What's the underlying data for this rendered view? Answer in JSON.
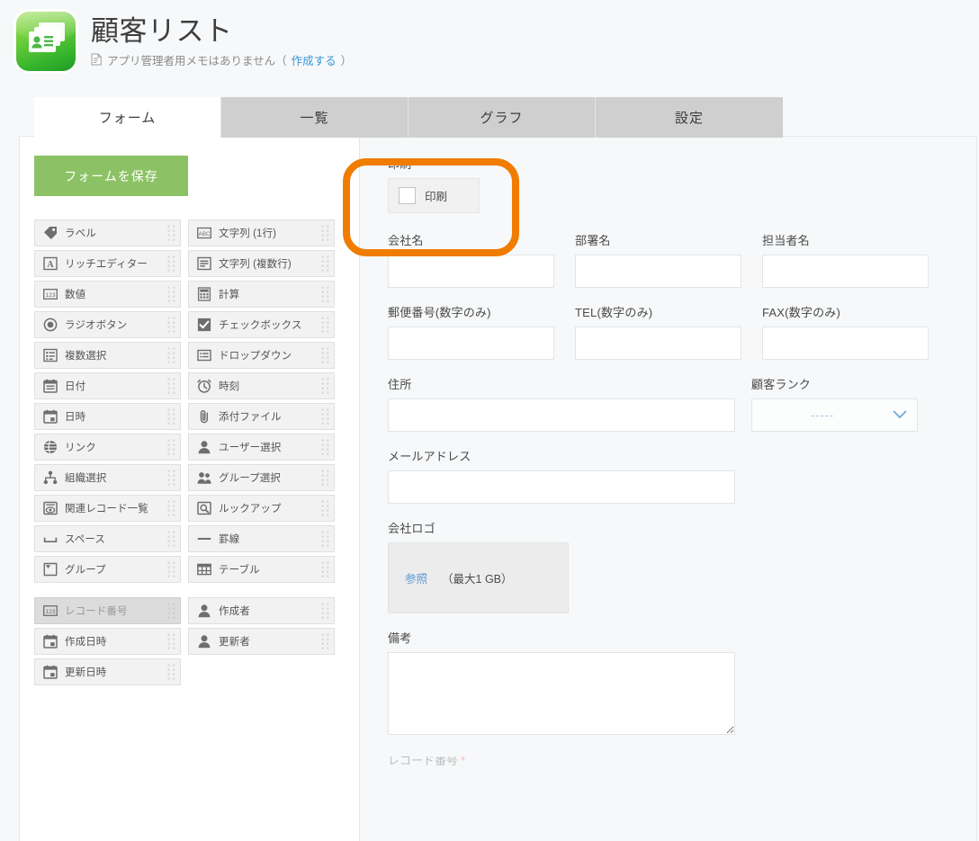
{
  "header": {
    "app_icon_name": "contact-cards-icon",
    "title": "顧客リスト",
    "note_icon": "memo-icon",
    "note_text": "アプリ管理者用メモはありません（",
    "note_link": "作成する",
    "note_suffix": "）"
  },
  "tabs": [
    {
      "label": "フォーム",
      "active": true
    },
    {
      "label": "一覧",
      "active": false
    },
    {
      "label": "グラフ",
      "active": false
    },
    {
      "label": "設定",
      "active": false
    }
  ],
  "palette": {
    "save_label": "フォームを保存",
    "fields": [
      {
        "label": "ラベル",
        "icon": "tag-icon"
      },
      {
        "label": "文字列 (1行)",
        "icon": "abc-icon"
      },
      {
        "label": "リッチエディター",
        "icon": "rich-text-icon"
      },
      {
        "label": "文字列 (複数行)",
        "icon": "multiline-text-icon"
      },
      {
        "label": "数値",
        "icon": "number-123-icon"
      },
      {
        "label": "計算",
        "icon": "calculator-icon"
      },
      {
        "label": "ラジオボタン",
        "icon": "radio-button-icon"
      },
      {
        "label": "チェックボックス",
        "icon": "checkbox-icon"
      },
      {
        "label": "複数選択",
        "icon": "multi-select-icon"
      },
      {
        "label": "ドロップダウン",
        "icon": "dropdown-icon"
      },
      {
        "label": "日付",
        "icon": "calendar-icon"
      },
      {
        "label": "時刻",
        "icon": "clock-icon"
      },
      {
        "label": "日時",
        "icon": "calendar-time-icon"
      },
      {
        "label": "添付ファイル",
        "icon": "paperclip-icon"
      },
      {
        "label": "リンク",
        "icon": "globe-link-icon"
      },
      {
        "label": "ユーザー選択",
        "icon": "user-icon"
      },
      {
        "label": "組織選択",
        "icon": "org-tree-icon"
      },
      {
        "label": "グループ選択",
        "icon": "group-users-icon"
      },
      {
        "label": "関連レコード一覧",
        "icon": "related-records-icon"
      },
      {
        "label": "ルックアップ",
        "icon": "lookup-search-icon"
      },
      {
        "label": "スペース",
        "icon": "space-icon"
      },
      {
        "label": "罫線",
        "icon": "horizontal-rule-icon"
      },
      {
        "label": "グループ",
        "icon": "group-box-icon"
      },
      {
        "label": "テーブル",
        "icon": "table-icon"
      }
    ],
    "system_fields": [
      {
        "label": "レコード番号",
        "icon": "number-123-icon",
        "used": true
      },
      {
        "label": "作成者",
        "icon": "user-icon",
        "used": false
      },
      {
        "label": "作成日時",
        "icon": "calendar-time-icon",
        "used": false
      },
      {
        "label": "更新者",
        "icon": "user-icon",
        "used": false
      },
      {
        "label": "更新日時",
        "icon": "calendar-time-icon",
        "used": false
      }
    ]
  },
  "form": {
    "print_group_label": "印刷",
    "print_checkbox_label": "印刷",
    "print_checked": false,
    "company_name_label": "会社名",
    "company_name_value": "",
    "department_label": "部署名",
    "department_value": "",
    "contact_person_label": "担当者名",
    "contact_person_value": "",
    "postal_code_label": "郵便番号(数字のみ)",
    "postal_code_value": "",
    "tel_label": "TEL(数字のみ)",
    "tel_value": "",
    "fax_label": "FAX(数字のみ)",
    "fax_value": "",
    "address_label": "住所",
    "address_value": "",
    "rank_label": "顧客ランク",
    "rank_value": "-----",
    "email_label": "メールアドレス",
    "email_value": "",
    "logo_label": "会社ロゴ",
    "logo_browse_label": "参照",
    "logo_limit_label": "（最大1 GB）",
    "remarks_label": "備考",
    "remarks_value": "",
    "cut_off_label": "レコード番号"
  },
  "annotation": {
    "name": "print-field-highlight",
    "color": "#f07c00"
  },
  "colors": {
    "accent_green": "#8cc265",
    "tab_inactive": "#cfcfcf",
    "canvas_bg": "#f7f8f9",
    "link_blue": "#3498db",
    "highlight_orange": "#f07c00"
  }
}
